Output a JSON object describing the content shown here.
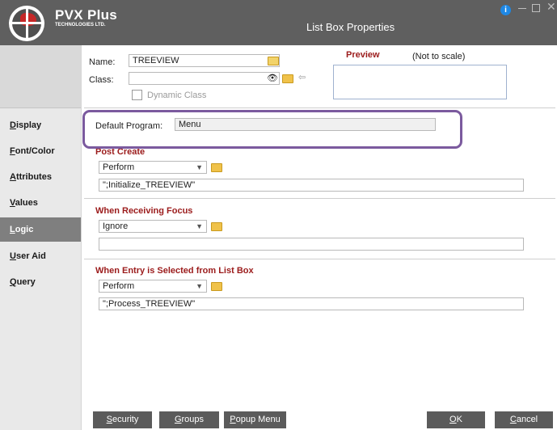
{
  "window": {
    "brand": "PVX Plus",
    "brand_sub": "TECHNOLOGIES LTD.",
    "title": "List Box Properties"
  },
  "sidebar": {
    "items": [
      {
        "label": "Display"
      },
      {
        "label": "Font/Color"
      },
      {
        "label": "Attributes"
      },
      {
        "label": "Values"
      },
      {
        "label": "Logic"
      },
      {
        "label": "User Aid"
      },
      {
        "label": "Query"
      }
    ],
    "active": "Logic"
  },
  "form": {
    "name_label": "Name:",
    "name_value": "TREEVIEW",
    "class_label": "Class:",
    "class_value": "",
    "dynamic_class_label": "Dynamic Class",
    "preview_label": "Preview",
    "preview_note": "(Not to scale)",
    "default_program_label": "Default Program:",
    "default_program_value": "Menu"
  },
  "sections": {
    "post_create": {
      "title": "Post Create",
      "mode": "Perform",
      "value": "\";Initialize_TREEVIEW\""
    },
    "receiving_focus": {
      "title": "When Receiving Focus",
      "mode": "Ignore",
      "value": ""
    },
    "entry_selected": {
      "title": "When Entry is Selected from List Box",
      "mode": "Perform",
      "value": "\";Process_TREEVIEW\""
    }
  },
  "buttons": {
    "security": "Security",
    "groups": "Groups",
    "popup_menu": "Popup Menu",
    "ok": "OK",
    "cancel": "Cancel"
  },
  "colors": {
    "titlebar": "#5f5f5f",
    "section_title": "#9b1b1b",
    "highlight": "#7b5a9e",
    "active_nav": "#7f7f7f",
    "button": "#5b5b5b"
  }
}
